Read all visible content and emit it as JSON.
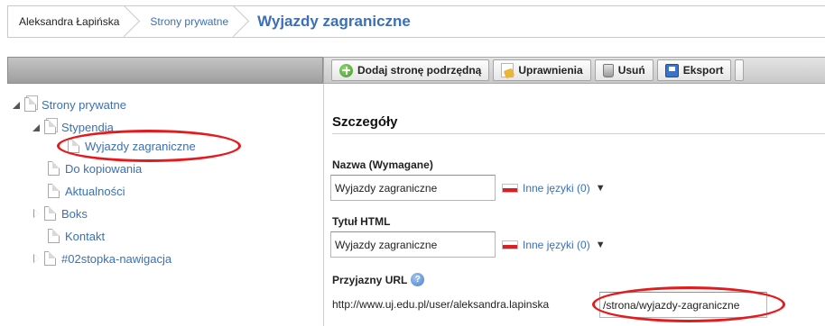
{
  "breadcrumb": {
    "items": [
      "Aleksandra Łapińska",
      "Strony prywatne"
    ],
    "current": "Wyjazdy zagraniczne"
  },
  "toolbar": {
    "add_subpage": "Dodaj stronę podrzędną",
    "permissions": "Uprawnienia",
    "delete": "Usuń",
    "export": "Eksport"
  },
  "tree": {
    "root": "Strony prywatne",
    "stypendia": "Stypendia",
    "wyjazdy": "Wyjazdy zagraniczne",
    "do_kopiowania": "Do kopiowania",
    "aktualnosci": "Aktualności",
    "boks": "Boks",
    "kontakt": "Kontakt",
    "stopka": "#02stopka-nawigacja"
  },
  "details": {
    "title": "Szczegóły",
    "name_label": "Nazwa (Wymagane)",
    "name_value": "Wyjazdy zagraniczne",
    "other_languages": "Inne języki (0)",
    "html_title_label": "Tytuł HTML",
    "html_title_value": "Wyjazdy zagraniczne",
    "friendly_url_label": "Przyjazny URL",
    "url_prefix": "http://www.uj.edu.pl/user/aleksandra.lapinska",
    "url_value": "/strona/wyjazdy-zagraniczne"
  },
  "colors": {
    "link": "#3b6fb6",
    "highlight": "#e8191c"
  }
}
